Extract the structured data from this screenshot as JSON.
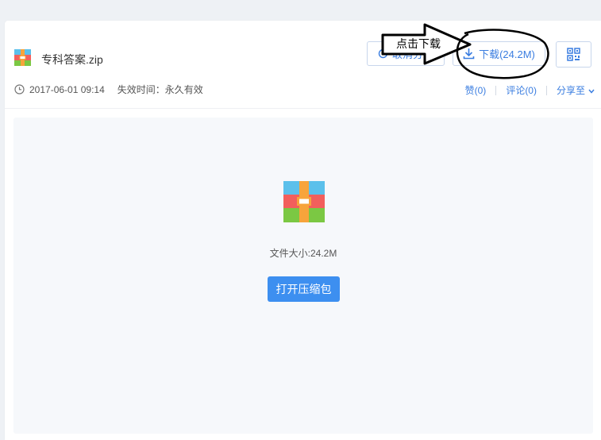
{
  "file": {
    "name": "专科答案.zip",
    "date": "2017-06-01 09:14",
    "expiry_label": "失效时间：",
    "expiry_value": "永久有效",
    "size_label": "文件大小:24.2M"
  },
  "buttons": {
    "cancel_share": "取消分享",
    "download": "下载(24.2M)",
    "open_archive": "打开压缩包",
    "qr_icon": "qr-code-icon"
  },
  "actions": {
    "like": "赞(0)",
    "comment": "评论(0)",
    "share": "分享至"
  },
  "annotation": {
    "text": "点击下载"
  },
  "colors": {
    "accent": "#3a7de0",
    "primary_button": "#3d8ff0",
    "archive_blue": "#5bc0eb",
    "archive_red": "#f25f5c",
    "archive_green": "#7bc843",
    "archive_orange": "#f7a43b"
  }
}
